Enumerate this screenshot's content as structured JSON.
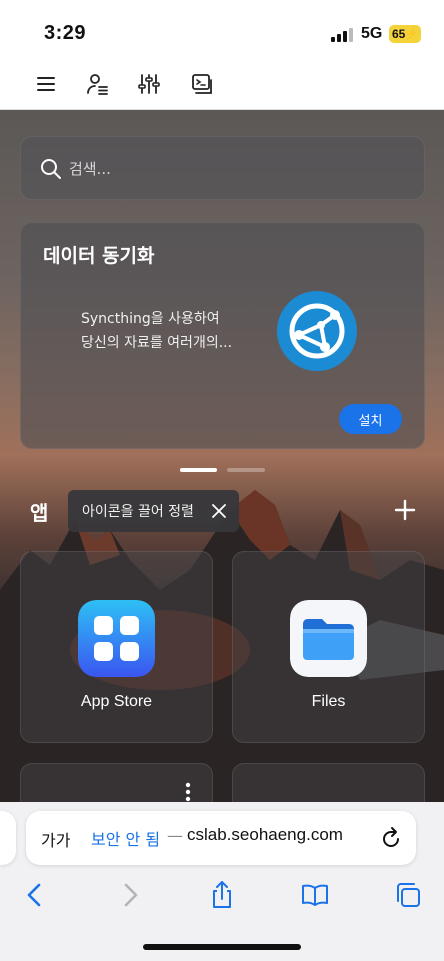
{
  "status_bar": {
    "time": "3:29",
    "network": "5G",
    "battery": "65"
  },
  "toolbar": {
    "icons": [
      "menu-icon",
      "user-list-icon",
      "sliders-icon",
      "terminal-icon"
    ]
  },
  "search": {
    "placeholder": "검색..."
  },
  "promo": {
    "title": "데이터 동기화",
    "line1": "Syncthing을 사용하여",
    "line2": "당신의 자료를 여러개의...",
    "install_label": "설치"
  },
  "apps_section": {
    "title": "앱",
    "tooltip": "아이콘을 끌어 정렬",
    "apps": [
      {
        "label": "App Store",
        "icon": "app-store-icon",
        "color": "#3b7cf6"
      },
      {
        "label": "Files",
        "icon": "folder-icon",
        "color": "#2f8df5"
      }
    ]
  },
  "browser": {
    "text_size": "가가",
    "security": "보안 안 됨",
    "separator": "—",
    "domain": "cslab.seohaeng.com"
  },
  "colors": {
    "accent": "#1a73e8",
    "battery": "#f4d23a"
  }
}
